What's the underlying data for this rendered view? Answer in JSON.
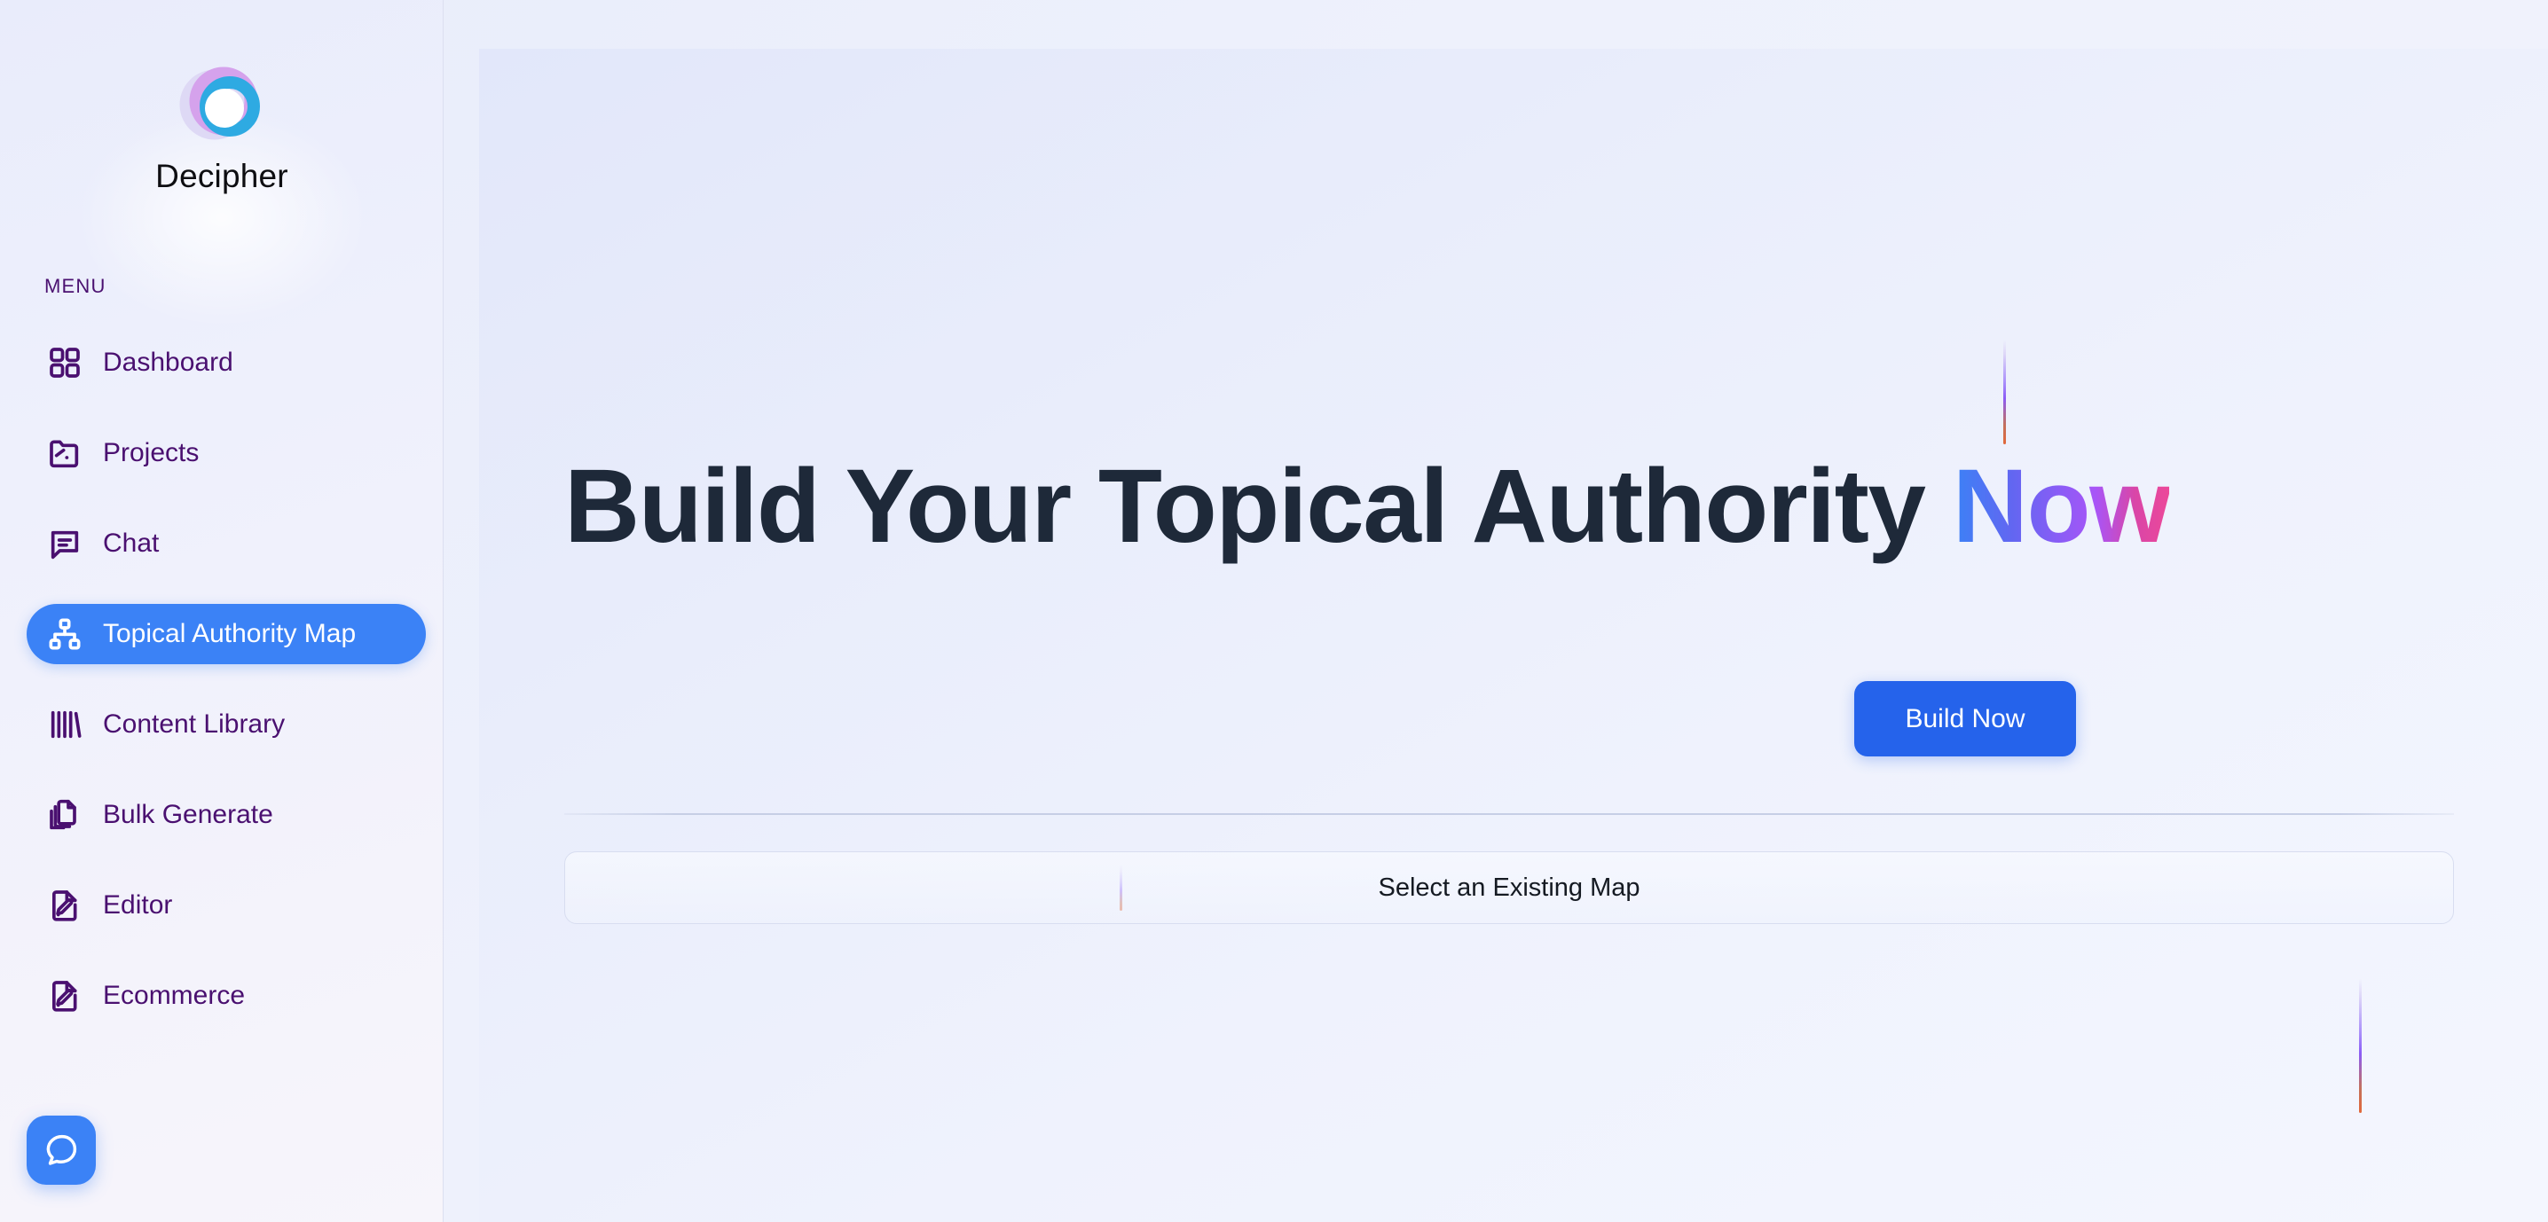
{
  "brand": {
    "name": "Decipher",
    "logo_icon": "decipher-rings-logo",
    "ring_colors": [
      "#ded9f5",
      "#d5a2ec",
      "#2eaae2"
    ]
  },
  "sidebar": {
    "section_label": "MENU",
    "text_color": "#4a1070",
    "active_color": "#3b82f6",
    "items": [
      {
        "label": "Dashboard",
        "icon": "grid-icon",
        "active": false
      },
      {
        "label": "Projects",
        "icon": "folder-open-icon",
        "active": false
      },
      {
        "label": "Chat",
        "icon": "message-square-icon",
        "active": false
      },
      {
        "label": "Topical Authority Map",
        "icon": "sitemap-icon",
        "active": true
      },
      {
        "label": "Content Library",
        "icon": "library-books-icon",
        "active": false
      },
      {
        "label": "Bulk Generate",
        "icon": "copy-documents-icon",
        "active": false
      },
      {
        "label": "Editor",
        "icon": "file-pencil-icon",
        "active": false
      },
      {
        "label": "Ecommerce",
        "icon": "file-pencil-icon",
        "active": false
      }
    ],
    "chat_fab": {
      "icon": "chat-bubble-icon",
      "color": "#3b82f6"
    }
  },
  "main": {
    "headline_prefix": "Build Your Topical Authority ",
    "headline_accent": "Now",
    "headline_color": "#1e2939",
    "accent_gradient": [
      "#3b82f6",
      "#8b5cf6",
      "#ec4899"
    ],
    "build_button": {
      "label": "Build Now",
      "color": "#2563eb"
    },
    "select_map": {
      "label": "Select an Existing Map"
    }
  }
}
